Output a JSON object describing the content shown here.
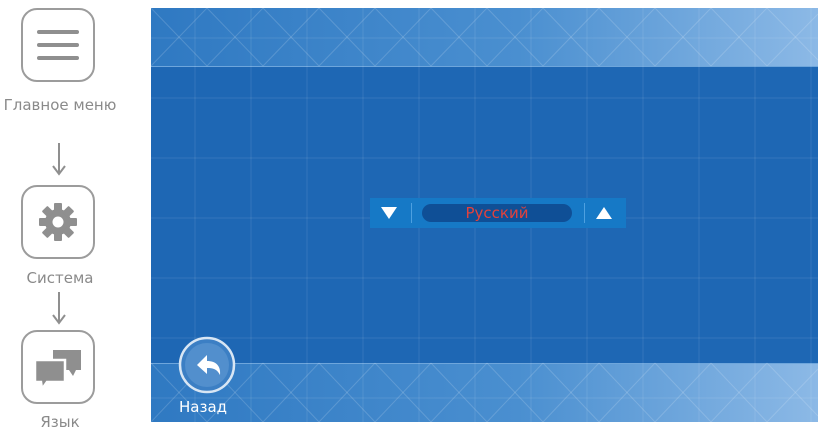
{
  "instructions": {
    "steps": [
      {
        "label": "Главное меню",
        "icon": "menu-icon"
      },
      {
        "label": "Система",
        "icon": "gear-icon"
      },
      {
        "label": "Язык",
        "icon": "chat-bubbles-icon"
      }
    ]
  },
  "screen": {
    "language_selector": {
      "value": "Русский",
      "prev_icon": "triangle-down-icon",
      "next_icon": "triangle-up-icon"
    },
    "back_button": {
      "label": "Назад",
      "icon": "back-arrow-icon"
    }
  },
  "colors": {
    "screen_bg": "#1e67b4",
    "selected_text": "#e2423c",
    "step_border": "#9c9c9c",
    "step_text": "#8a8a8a"
  }
}
